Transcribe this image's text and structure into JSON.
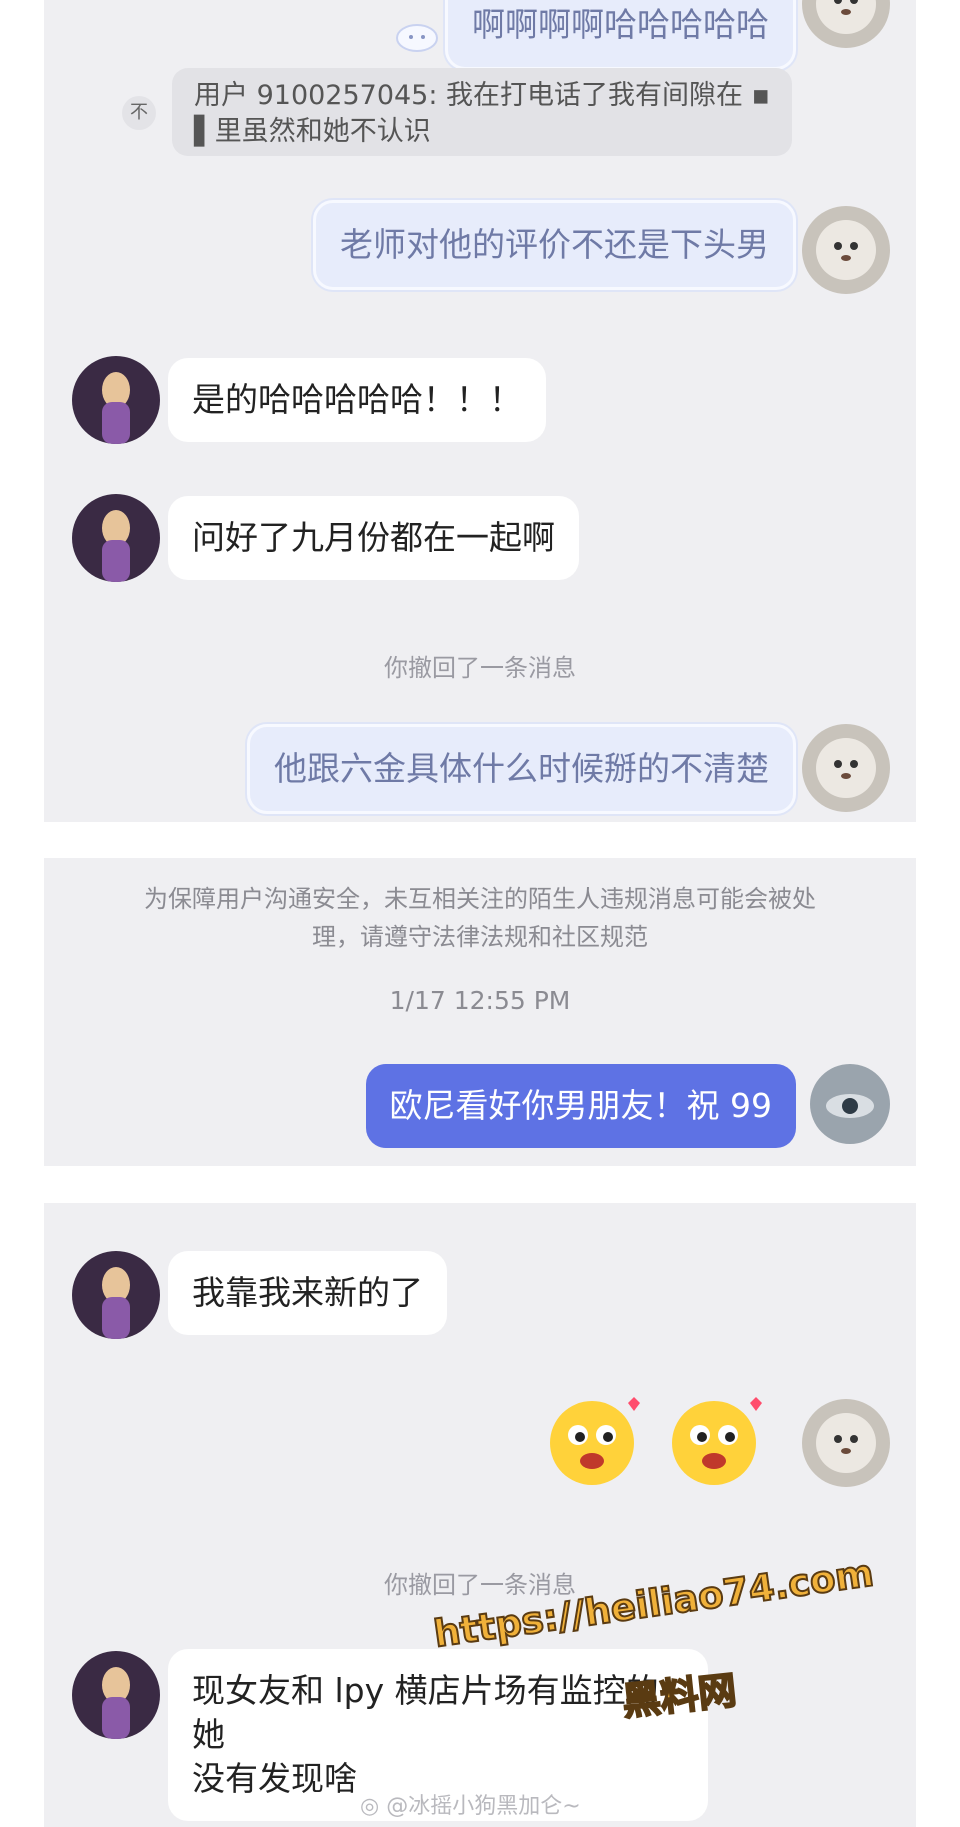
{
  "panel1": {
    "top_message": "啊啊啊啊哈哈哈哈哈",
    "quote_text": "用户 9100257045: 我在打电话了我有间隙在 ▪ ▌里虽然和她不认识",
    "quote_icon": "不",
    "sent_cloud_1": "老师对他的评价不还是下头男",
    "received_1": "是的哈哈哈哈哈！！！",
    "received_2": "问好了九月份都在一起啊",
    "recall_notice": "你撤回了一条消息",
    "sent_cloud_2": "他跟六金具体什么时候掰的不清楚"
  },
  "panel2": {
    "notice": "为保障用户沟通安全，未互相关注的陌生人违规消息可能会被处理，请遵守法律法规和社区规范",
    "timestamp": "1/17 12:55 PM",
    "sent_blue": "欧尼看好你男朋友！祝 99"
  },
  "panel3": {
    "received_1": "我靠我来新的了",
    "recall_notice": "你撤回了一条消息",
    "received_2_line1": "现女友和 lpy 横店片场有监控的 她",
    "received_2_line2": "没有发现啥"
  },
  "overlay": {
    "watermark_url": "https://heiliao74.com",
    "watermark_cn": "黑料网",
    "weibo_tag": "@冰摇小狗黑加仑~"
  },
  "icons": [
    "avatar-girl-icon",
    "avatar-dog-icon",
    "avatar-eye-icon",
    "cloud-sticker-icon",
    "heart-eyes-emoji-icon",
    "weibo-icon"
  ],
  "colors": {
    "panel": "#efeff2",
    "blue_bubble": "#5e72e4",
    "cloud_bubble": "#e7ecfb",
    "watermark": "#f0b13a"
  }
}
